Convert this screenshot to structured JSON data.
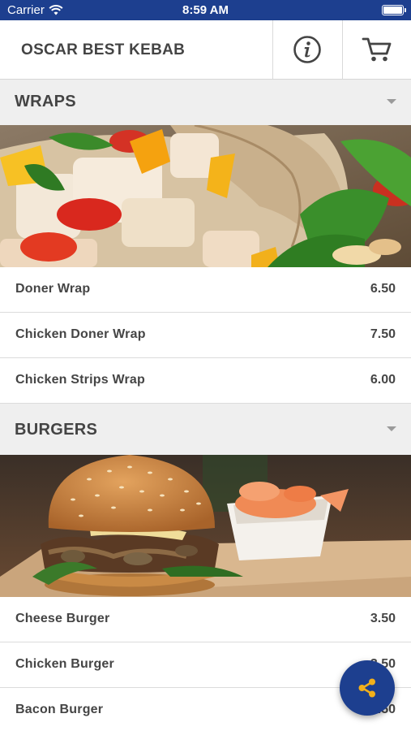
{
  "status_bar": {
    "carrier": "Carrier",
    "time": "8:59 AM"
  },
  "header": {
    "title": "OSCAR BEST KEBAB",
    "info_icon": "info-icon",
    "cart_icon": "cart-icon"
  },
  "sections": [
    {
      "title": "WRAPS",
      "items": [
        {
          "name": "Doner Wrap",
          "price": "6.50"
        },
        {
          "name": "Chicken Doner Wrap",
          "price": "7.50"
        },
        {
          "name": "Chicken Strips Wrap",
          "price": "6.00"
        }
      ]
    },
    {
      "title": "BURGERS",
      "items": [
        {
          "name": "Cheese Burger",
          "price": "3.50"
        },
        {
          "name": "Chicken Burger",
          "price": "3.50"
        },
        {
          "name": "Bacon Burger",
          "price": "3.50"
        }
      ]
    }
  ],
  "fab": {
    "icon": "share-icon"
  },
  "colors": {
    "brand": "#1d3f8f",
    "section_bg": "#efefef",
    "text": "#454545"
  }
}
